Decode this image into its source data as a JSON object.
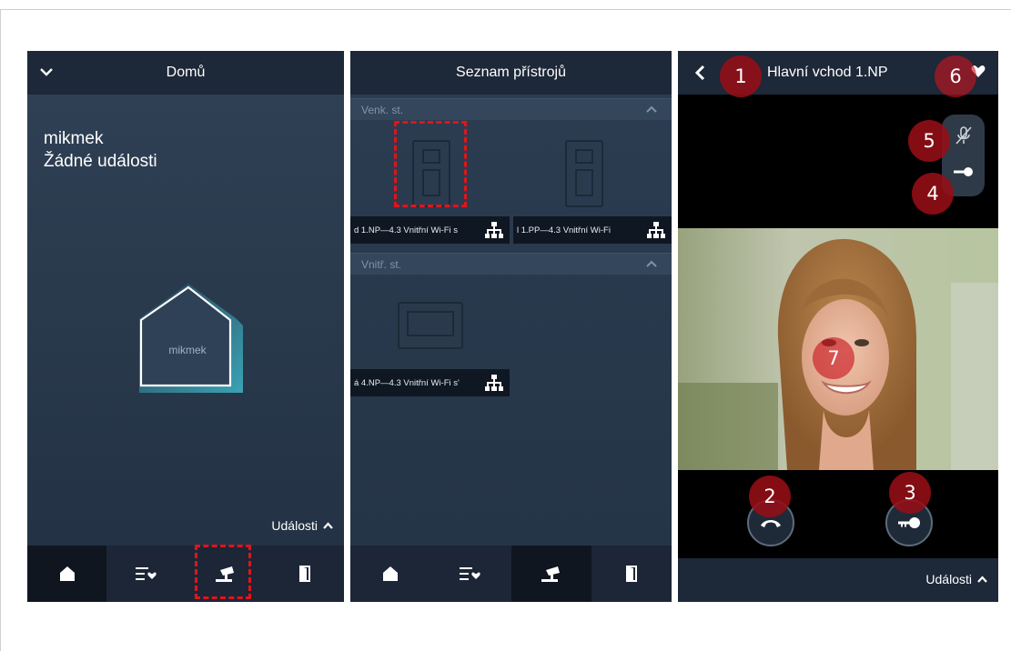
{
  "screen1": {
    "title": "Domů",
    "user_name": "mikmek",
    "no_events": "Žádné události",
    "house_label": "mikmek",
    "events_label": "Události"
  },
  "screen2": {
    "title": "Seznam přístrojů",
    "section_outdoor": "Venk. st.",
    "section_indoor": "Vnitř. st.",
    "device1_label": "d 1.NP—4.3 Vnitřní Wi-Fi s",
    "device2_label": "l 1.PP—4.3 Vnitřní Wi-Fi",
    "device3_label": "á 4.NP—4.3 Vnitřní Wi-Fi s'"
  },
  "screen3": {
    "title": "Hlavní vchod 1.NP",
    "events_label": "Události"
  },
  "badges": [
    "1",
    "2",
    "3",
    "4",
    "5",
    "6",
    "7"
  ],
  "colors": {
    "accent_red": "#e0141b",
    "badge_red": "#960e16",
    "topbar": "#1d2838",
    "house_teal": "#3ea7b8"
  },
  "icons": {
    "nav": [
      "home-icon",
      "favorites-list-icon",
      "camera-icon",
      "door-icon"
    ],
    "header": [
      "chevron-down-icon",
      "back-icon",
      "heart-icon"
    ],
    "controls": [
      "mute-microphone-icon",
      "door-key-icon",
      "hang-up-icon",
      "unlock-key-icon",
      "network-icon"
    ]
  }
}
